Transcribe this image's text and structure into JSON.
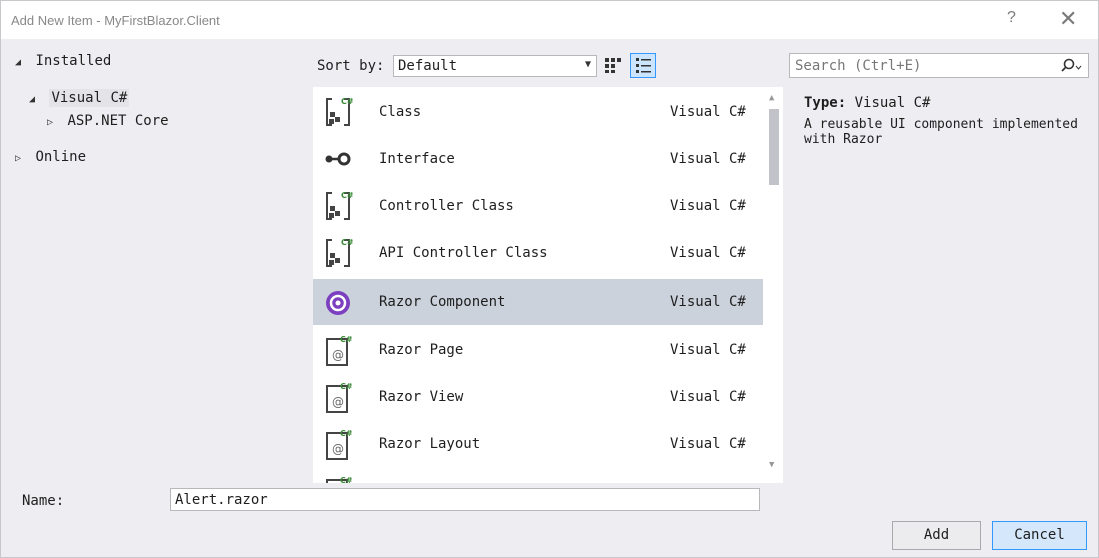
{
  "window": {
    "title": "Add New Item - MyFirstBlazor.Client",
    "help_label": "?",
    "close_label": "✕"
  },
  "tree": {
    "installed": "Installed",
    "visual_csharp": "Visual C#",
    "aspnet_core": "ASP.NET Core",
    "online": "Online"
  },
  "sort": {
    "label": "Sort by:",
    "value": "Default"
  },
  "search": {
    "placeholder": "Search (Ctrl+E)"
  },
  "items": [
    {
      "name": "Class",
      "lang": "Visual C#",
      "icon": "class-icon"
    },
    {
      "name": "Interface",
      "lang": "Visual C#",
      "icon": "interface-icon"
    },
    {
      "name": "Controller Class",
      "lang": "Visual C#",
      "icon": "controller-class-icon"
    },
    {
      "name": "API Controller Class",
      "lang": "Visual C#",
      "icon": "api-controller-class-icon"
    },
    {
      "name": "Razor Component",
      "lang": "Visual C#",
      "icon": "razor-component-icon"
    },
    {
      "name": "Razor Page",
      "lang": "Visual C#",
      "icon": "razor-page-icon"
    },
    {
      "name": "Razor View",
      "lang": "Visual C#",
      "icon": "razor-view-icon"
    },
    {
      "name": "Razor Layout",
      "lang": "Visual C#",
      "icon": "razor-layout-icon"
    }
  ],
  "details": {
    "type_label": "Type:",
    "type_value": "Visual C#",
    "description": "A reusable UI component implemented with Razor"
  },
  "name": {
    "label": "Name:",
    "value": "Alert.razor"
  },
  "buttons": {
    "add": "Add",
    "cancel": "Cancel"
  },
  "colors": {
    "selection": "#ccd2dc",
    "accent": "#3399ff",
    "razor_purple": "#7b3fbf"
  }
}
